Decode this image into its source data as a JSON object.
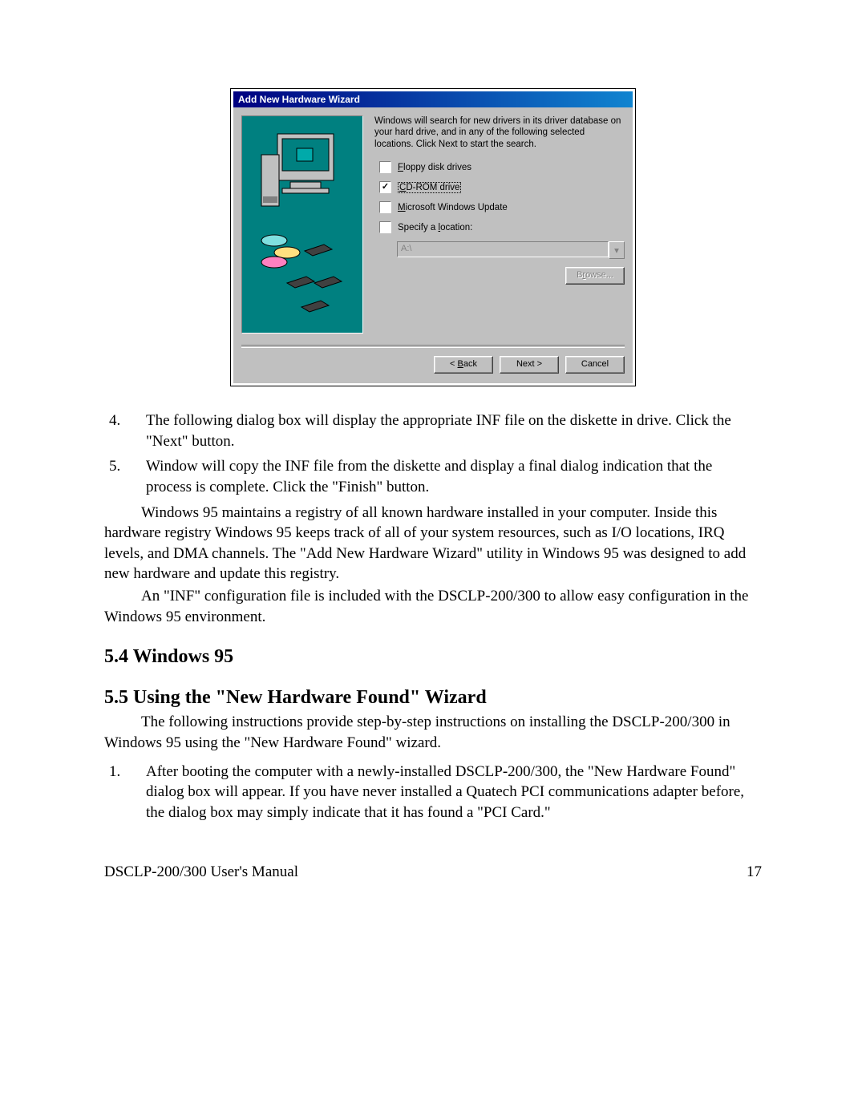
{
  "dialog": {
    "title": "Add New Hardware Wizard",
    "intro": "Windows will search for new drivers in its driver database on your hard drive, and in any of the following selected locations. Click Next to start the search.",
    "options": {
      "floppy": "Floppy disk drives",
      "cdrom": "CD-ROM drive",
      "winupdate": "Microsoft Windows Update",
      "specify": "Specify a location:"
    },
    "location_value": "A:\\",
    "buttons": {
      "browse": "Browse...",
      "back": "< Back",
      "next": "Next >",
      "cancel": "Cancel"
    },
    "checked": {
      "floppy": false,
      "cdrom": true,
      "winupdate": false,
      "specify": false
    }
  },
  "steps": {
    "n4": "4.",
    "t4": "The following dialog box will display the appropriate INF file on the diskette in drive. Click the \"Next\" button.",
    "n5": "5.",
    "t5": "Window will copy the INF file from the diskette and display a final dialog indication that the process is complete. Click the \"Finish\" button."
  },
  "body": {
    "p1": "Windows 95 maintains a registry of all known hardware installed in your computer.  Inside this hardware registry Windows 95 keeps track of all of your system resources, such as I/O locations, IRQ levels, and DMA channels.  The \"Add New Hardware Wizard\" utility in Windows 95 was designed to add new hardware and update this registry.",
    "p2": "An \"INF\" configuration file is included with the DSCLP-200/300 to allow easy configuration in the Windows 95 environment."
  },
  "headings": {
    "h54": "5.4  Windows 95",
    "h55": "5.5  Using the \"New Hardware Found\" Wizard"
  },
  "body2": {
    "p3": "The following instructions provide step-by-step instructions on installing the DSCLP-200/300 in Windows 95 using the \"New Hardware Found\" wizard."
  },
  "steps2": {
    "n1": "1.",
    "t1": "After booting the computer with a newly-installed DSCLP-200/300, the \"New Hardware Found\" dialog box will appear.  If you have never installed a Quatech PCI communications adapter before, the dialog box may simply indicate that it has found a \"PCI Card.\""
  },
  "footer": {
    "left": "DSCLP-200/300 User's Manual",
    "right": "17"
  }
}
